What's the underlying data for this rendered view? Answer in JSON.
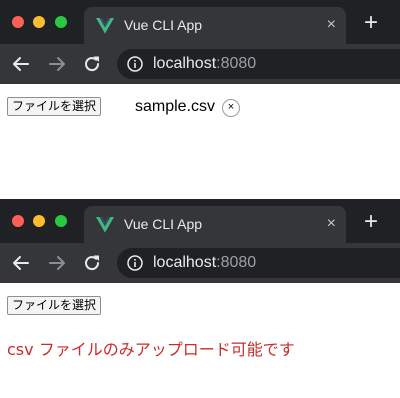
{
  "frames": [
    {
      "tab": {
        "title": "Vue CLI App",
        "close_glyph": "×",
        "icon": "vue-logo-icon"
      },
      "new_tab_glyph": "+",
      "address": {
        "host": "localhost",
        "port": ":8080"
      },
      "file_input": {
        "button_label": "ファイルを選択",
        "selected_file": "sample.csv",
        "clear_glyph": "×"
      }
    },
    {
      "tab": {
        "title": "Vue CLI App",
        "close_glyph": "×",
        "icon": "vue-logo-icon"
      },
      "new_tab_glyph": "+",
      "address": {
        "host": "localhost",
        "port": ":8080"
      },
      "file_input": {
        "button_label": "ファイルを選択"
      },
      "error_message": "csv ファイルのみアップロード可能です"
    }
  ],
  "colors": {
    "tabbar_bg": "#202124",
    "toolbar_bg": "#35363a",
    "error_text": "#cc2b2b",
    "vue_green": "#41b883",
    "vue_dark": "#35495e"
  }
}
